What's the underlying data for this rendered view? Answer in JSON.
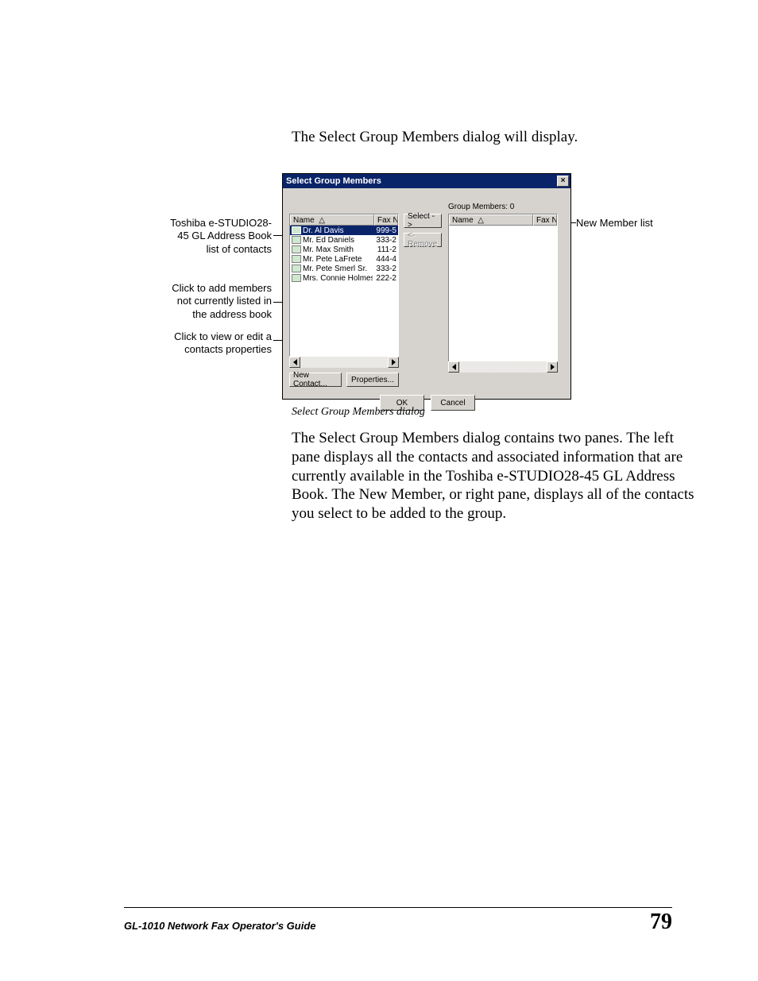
{
  "intro_text": "The Select Group Members dialog will display.",
  "caption": "Select Group Members dialog",
  "body_paragraph": "The Select Group Members dialog contains two panes. The left pane displays all the contacts and associated information that are currently available in the Toshiba e-STUDIO28-45 GL Address Book. The New Member, or right pane, displays all of the contacts you select to be added to the group.",
  "callouts": {
    "contacts_list": "Toshiba e-STUDIO28-\n45 GL Address Book\nlist of contacts",
    "add_members": "Click to add members\nnot currently listed in\nthe address book",
    "properties": "Click to view or edit a\ncontacts properties",
    "new_member_list": "New Member list"
  },
  "dialog": {
    "title": "Select Group Members",
    "group_members_label": "Group Members: 0",
    "columns": {
      "name": "Name",
      "fax": "Fax N"
    },
    "contacts": [
      {
        "name": "Dr. Al Davis",
        "fax": "999-5",
        "selected": true
      },
      {
        "name": "Mr. Ed Daniels",
        "fax": "333-2",
        "selected": false
      },
      {
        "name": "Mr. Max Smith",
        "fax": "111-2",
        "selected": false
      },
      {
        "name": "Mr. Pete LaFrete",
        "fax": "444-4",
        "selected": false
      },
      {
        "name": "Mr. Pete Smerl Sr.",
        "fax": "333-2",
        "selected": false
      },
      {
        "name": "Mrs. Connie Holmes",
        "fax": "222-2",
        "selected": false
      }
    ],
    "buttons": {
      "select": "Select ->",
      "remove": "<- Remove",
      "new_contact": "New Contact...",
      "properties": "Properties...",
      "ok": "OK",
      "cancel": "Cancel"
    }
  },
  "footer": {
    "guide": "GL-1010 Network Fax Operator's Guide",
    "page": "79"
  }
}
